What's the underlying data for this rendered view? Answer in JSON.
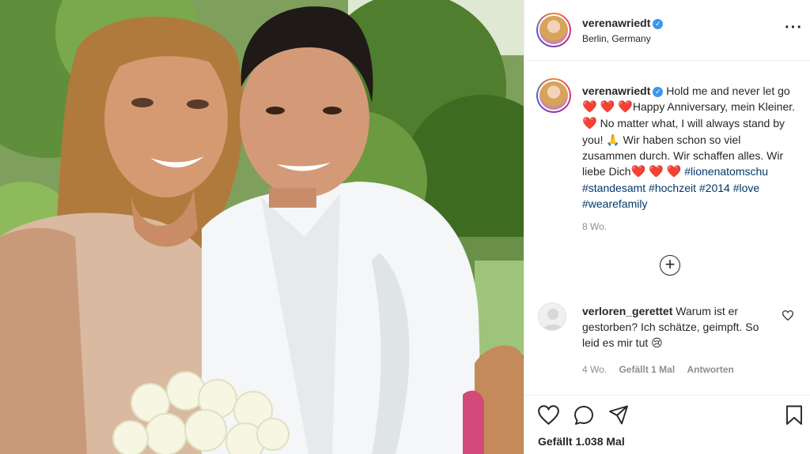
{
  "post": {
    "photo_alt": ""
  },
  "header": {
    "username": "verenawriedt",
    "location": "Berlin, Germany",
    "more_label": "···"
  },
  "caption": {
    "username": "verenawriedt",
    "part1": "Hold me and never let go ",
    "part2": "Happy Anniversary, mein Kleiner. ",
    "part3": " No matter what, I will always stand by you! ",
    "part4": " Wir haben schon so viel zusammen durch. Wir schaffen alles. Wir liebe Dich",
    "hashtags": "#lionenatomschu #standesamt #hochzeit #2014 #love #wearefamily",
    "age": "8 Wo."
  },
  "load_more_label": "+",
  "comment": {
    "username": "verloren_gerettet",
    "text": " Warum ist er gestorben? Ich schätze, geimpft. So leid es mir tut ",
    "age": "4 Wo.",
    "likes": "Gefällt 1 Mal",
    "reply": "Antworten"
  },
  "actions": {
    "likes": "Gefällt 1.038 Mal"
  },
  "colors": {
    "verified": "#3897f0",
    "heart": "#e0163a",
    "hashtag": "#00376b",
    "muted": "#8e8e8e"
  },
  "icons": [
    "heart-icon",
    "comment-icon",
    "share-icon",
    "bookmark-icon",
    "verified-icon",
    "more-icon",
    "plus-circle-icon"
  ]
}
